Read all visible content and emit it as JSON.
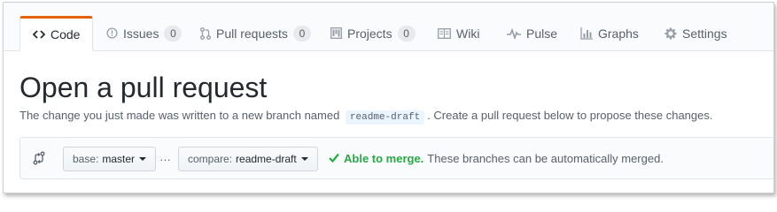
{
  "tabs": [
    {
      "label": "Code",
      "icon": "code-icon",
      "selected": true
    },
    {
      "label": "Issues",
      "icon": "issue-opened-icon",
      "count": "0"
    },
    {
      "label": "Pull requests",
      "icon": "git-pull-request-icon",
      "count": "0"
    },
    {
      "label": "Projects",
      "icon": "project-icon",
      "count": "0"
    },
    {
      "label": "Wiki",
      "icon": "book-icon"
    },
    {
      "label": "Pulse",
      "icon": "pulse-icon"
    },
    {
      "label": "Graphs",
      "icon": "graph-icon"
    },
    {
      "label": "Settings",
      "icon": "gear-icon"
    }
  ],
  "page": {
    "title": "Open a pull request",
    "subtitle_before": "The change you just made was written to a new branch named",
    "branch_name": "readme-draft",
    "subtitle_after": ". Create a pull request below to propose these changes."
  },
  "compare": {
    "base_prefix": "base:",
    "base_value": "master",
    "separator": "…",
    "compare_prefix": "compare:",
    "compare_value": "readme-draft",
    "status_label": "Able to merge.",
    "status_message": "These branches can be automatically merged."
  },
  "colors": {
    "accent_tab": "#e36209",
    "merge_ok": "#28a745",
    "branch_bg": "#eaf5ff"
  }
}
